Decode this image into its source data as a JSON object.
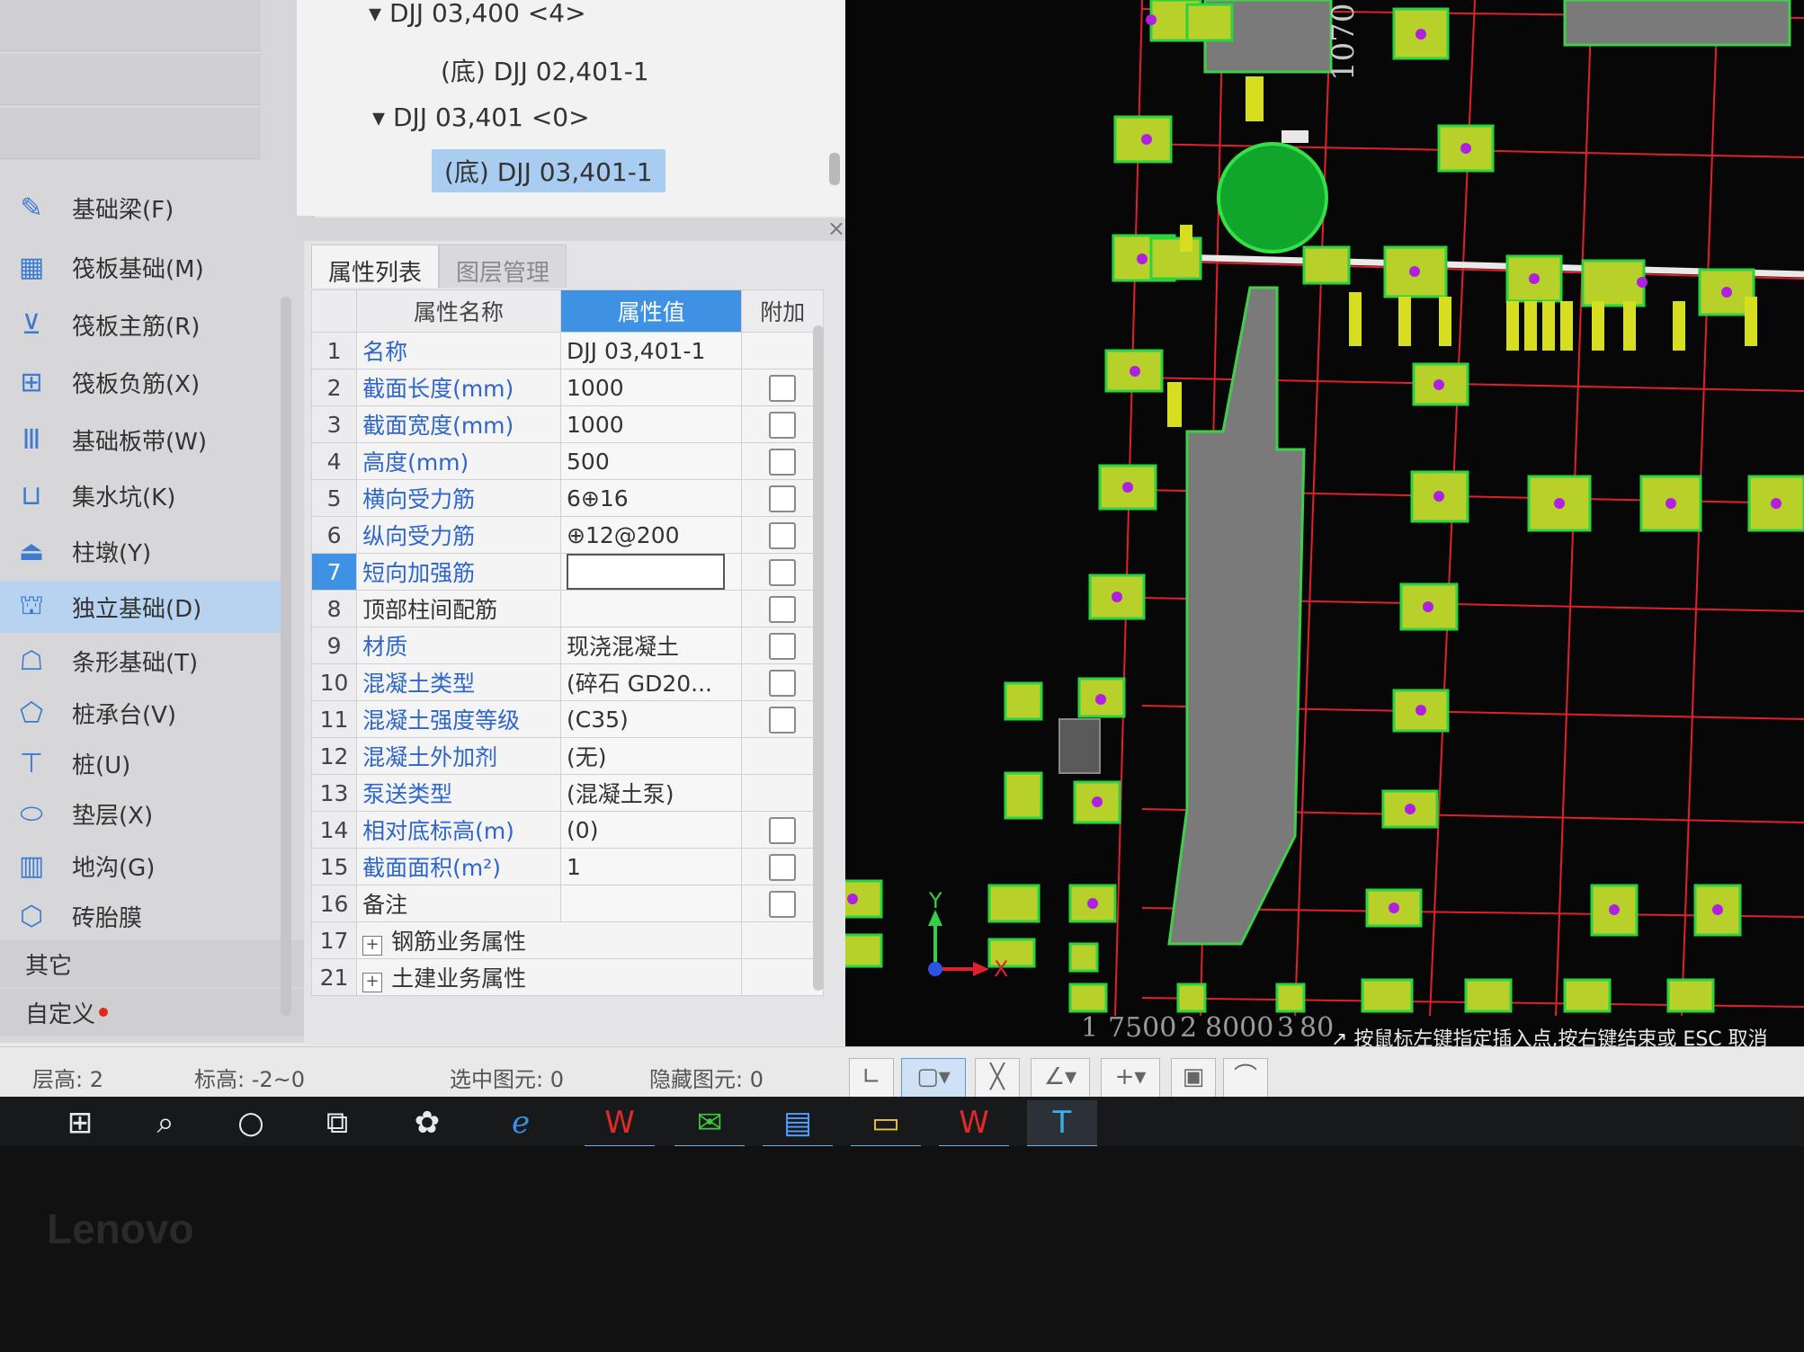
{
  "left_nav": {
    "items": [
      {
        "label": "基础梁(F)",
        "icon": "beam-icon"
      },
      {
        "label": "筏板基础(M)",
        "icon": "raft-icon"
      },
      {
        "label": "筏板主筋(R)",
        "icon": "main-rebar-icon"
      },
      {
        "label": "筏板负筋(X)",
        "icon": "neg-rebar-icon"
      },
      {
        "label": "基础板带(W)",
        "icon": "strip-icon"
      },
      {
        "label": "集水坑(K)",
        "icon": "sump-icon"
      },
      {
        "label": "柱墩(Y)",
        "icon": "pier-icon"
      },
      {
        "label": "独立基础(D)",
        "icon": "footing-icon"
      },
      {
        "label": "条形基础(T)",
        "icon": "strip-footing-icon"
      },
      {
        "label": "桩承台(V)",
        "icon": "pile-cap-icon"
      },
      {
        "label": "桩(U)",
        "icon": "pile-icon"
      },
      {
        "label": "垫层(X)",
        "icon": "cushion-icon"
      },
      {
        "label": "地沟(G)",
        "icon": "trench-icon"
      },
      {
        "label": "砖胎膜",
        "icon": "brick-icon"
      }
    ],
    "group_other": "其它",
    "group_custom": "自定义"
  },
  "tree": {
    "node1": "DJJ 03,400 <4>",
    "node2": "(底) DJJ 02,401-1",
    "node3": "DJJ 03,401 <0>",
    "node4": "(底) DJJ 03,401-1"
  },
  "props": {
    "tab_list": "属性列表",
    "tab_layers": "图层管理",
    "col_name": "属性名称",
    "col_value": "属性值",
    "col_add": "附加",
    "rows": [
      {
        "no": "1",
        "name": "名称",
        "value": "DJJ 03,401-1"
      },
      {
        "no": "2",
        "name": "截面长度(mm)",
        "value": "1000"
      },
      {
        "no": "3",
        "name": "截面宽度(mm)",
        "value": "1000"
      },
      {
        "no": "4",
        "name": "高度(mm)",
        "value": "500"
      },
      {
        "no": "5",
        "name": "横向受力筋",
        "value": "6⊕16"
      },
      {
        "no": "6",
        "name": "纵向受力筋",
        "value": "⊕12@200"
      },
      {
        "no": "7",
        "name": "短向加强筋",
        "value": ""
      },
      {
        "no": "8",
        "name": "顶部柱间配筋",
        "value": ""
      },
      {
        "no": "9",
        "name": "材质",
        "value": "现浇混凝土"
      },
      {
        "no": "10",
        "name": "混凝土类型",
        "value": "(碎石 GD20..."
      },
      {
        "no": "11",
        "name": "混凝土强度等级",
        "value": "(C35)"
      },
      {
        "no": "12",
        "name": "混凝土外加剂",
        "value": "(无)"
      },
      {
        "no": "13",
        "name": "泵送类型",
        "value": "(混凝土泵)"
      },
      {
        "no": "14",
        "name": "相对底标高(m)",
        "value": "(0)"
      },
      {
        "no": "15",
        "name": "截面面积(m²)",
        "value": "1"
      },
      {
        "no": "16",
        "name": "备注",
        "value": ""
      },
      {
        "no": "17",
        "name": "钢筋业务属性",
        "value": ""
      },
      {
        "no": "21",
        "name": "土建业务属性",
        "value": ""
      }
    ]
  },
  "cad": {
    "dim_top": "1070",
    "dims": [
      "1",
      "7500",
      "2",
      "8000",
      "3",
      "80"
    ],
    "axis_y": "Y",
    "axis_x": "X",
    "hint": "按鼠标左键指定插入点,按右键结束或 ESC 取消"
  },
  "status": {
    "floor_height": "层高: 2",
    "elevation": "标高: -2~0",
    "selected": "选中图元: 0",
    "hidden": "隐藏图元: 0"
  },
  "brand": "Lenovo"
}
